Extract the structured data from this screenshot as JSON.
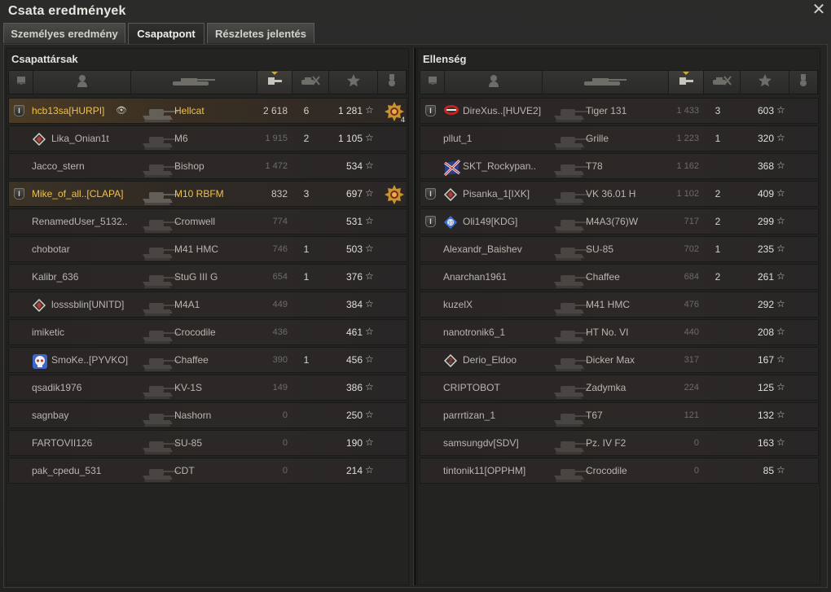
{
  "window": {
    "title": "Csata eredmények",
    "close_icon": "close-icon"
  },
  "tabs": [
    {
      "label": "Személyes eredmény",
      "active": false
    },
    {
      "label": "Csapatpont",
      "active": true
    },
    {
      "label": "Részletes jelentés",
      "active": false
    }
  ],
  "columns": [
    "squad-icon",
    "player-icon",
    "vehicle-icon",
    "damage-icon",
    "kills-icon",
    "xp-star-icon",
    "medal-icon"
  ],
  "colors": {
    "gold": "#f1c14d",
    "self_row": "#4b3b25",
    "squad_row": "#3c3326"
  },
  "allies": {
    "title": "Csapattársak",
    "rows": [
      {
        "squad": "I",
        "clan_icon": "",
        "name": "hcb13sa[HURPI]",
        "name_color": "gold",
        "eye": true,
        "vehicle": "Hellcat",
        "damage": "2 618",
        "kills": "6",
        "xp": "1 281",
        "medal": true,
        "medal_count": "4",
        "row_style": "self"
      },
      {
        "squad": "",
        "clan_icon": "diamond",
        "name": "Lika_Onian1t",
        "vehicle": "M6",
        "damage": "1 915",
        "kills": "2",
        "xp": "1 105",
        "row_style": "dead"
      },
      {
        "squad": "",
        "clan_icon": "",
        "name": "Jacco_stern",
        "vehicle": "Bishop",
        "damage": "1 472",
        "kills": "",
        "xp": "534",
        "row_style": "dead"
      },
      {
        "squad": "I",
        "clan_icon": "",
        "name": "Mike_of_all..[CLAPA]",
        "name_color": "gold",
        "vehicle": "M10 RBFM",
        "damage": "832",
        "kills": "3",
        "xp": "697",
        "medal": true,
        "medal_count": "",
        "row_style": "squad"
      },
      {
        "squad": "",
        "clan_icon": "",
        "name": "RenamedUser_5132..",
        "vehicle": "Cromwell",
        "damage": "774",
        "kills": "",
        "xp": "531",
        "row_style": "dead"
      },
      {
        "squad": "",
        "clan_icon": "",
        "name": "chobotar",
        "vehicle": "M41 HMC",
        "damage": "746",
        "kills": "1",
        "xp": "503",
        "row_style": "dead"
      },
      {
        "squad": "",
        "clan_icon": "",
        "name": "Kalibr_636",
        "vehicle": "StuG III G",
        "damage": "654",
        "kills": "1",
        "xp": "376",
        "row_style": "dead"
      },
      {
        "squad": "",
        "clan_icon": "diamond",
        "name": "losssblin[UNITD]",
        "vehicle": "M4A1",
        "damage": "449",
        "kills": "",
        "xp": "384",
        "row_style": "dead"
      },
      {
        "squad": "",
        "clan_icon": "",
        "name": "imiketic",
        "vehicle": "Crocodile",
        "damage": "436",
        "kills": "",
        "xp": "461",
        "row_style": "dead"
      },
      {
        "squad": "",
        "clan_icon": "skull",
        "name": "SmoKe..[PYVKO]",
        "vehicle": "Chaffee",
        "damage": "390",
        "kills": "1",
        "xp": "456",
        "row_style": "dead"
      },
      {
        "squad": "",
        "clan_icon": "",
        "name": "qsadik1976",
        "vehicle": "KV-1S",
        "damage": "149",
        "kills": "",
        "xp": "386",
        "row_style": "dead"
      },
      {
        "squad": "",
        "clan_icon": "",
        "name": "sagnbay",
        "vehicle": "Nashorn",
        "damage": "0",
        "kills": "",
        "xp": "250",
        "row_style": "dead"
      },
      {
        "squad": "",
        "clan_icon": "",
        "name": "FARTOVII126",
        "vehicle": "SU-85",
        "damage": "0",
        "kills": "",
        "xp": "190",
        "row_style": "dead"
      },
      {
        "squad": "",
        "clan_icon": "",
        "name": "pak_cpedu_531",
        "vehicle": "CDT",
        "damage": "0",
        "kills": "",
        "xp": "214",
        "row_style": "dead"
      }
    ]
  },
  "enemies": {
    "title": "Ellenség",
    "rows": [
      {
        "squad": "I",
        "clan_icon": "red-emblem",
        "name": "DireXus..[HUVE2]",
        "vehicle": "Tiger 131",
        "damage": "1 433",
        "kills": "3",
        "xp": "603",
        "row_style": "dead"
      },
      {
        "squad": "",
        "clan_icon": "",
        "name": "pllut_1",
        "vehicle": "Grille",
        "damage": "1 223",
        "kills": "1",
        "xp": "320",
        "row_style": "dead"
      },
      {
        "squad": "",
        "clan_icon": "flag",
        "name": "SKT_Rockypan..",
        "vehicle": "T78",
        "damage": "1 162",
        "kills": "",
        "xp": "368",
        "row_style": "dead"
      },
      {
        "squad": "I",
        "clan_icon": "diamond",
        "name": "Pisanka_1[IXK]",
        "vehicle": "VK 36.01 H",
        "damage": "1 102",
        "kills": "2",
        "xp": "409",
        "row_style": "dead"
      },
      {
        "squad": "I",
        "clan_icon": "blue-badge",
        "name": "Oli149[KDG]",
        "vehicle": "M4A3(76)W",
        "damage": "717",
        "kills": "2",
        "xp": "299",
        "row_style": "dead"
      },
      {
        "squad": "",
        "clan_icon": "",
        "name": "Alexandr_Baishev",
        "vehicle": "SU-85",
        "damage": "702",
        "kills": "1",
        "xp": "235",
        "row_style": "dead"
      },
      {
        "squad": "",
        "clan_icon": "",
        "name": "Anarchan1961",
        "vehicle": "Chaffee",
        "damage": "684",
        "kills": "2",
        "xp": "261",
        "row_style": "dead"
      },
      {
        "squad": "",
        "clan_icon": "",
        "name": "kuzelX",
        "vehicle": "M41 HMC",
        "damage": "476",
        "kills": "",
        "xp": "292",
        "row_style": "dead"
      },
      {
        "squad": "",
        "clan_icon": "",
        "name": "nanotronik6_1",
        "vehicle": "HT No. VI",
        "damage": "440",
        "kills": "",
        "xp": "208",
        "row_style": "dead"
      },
      {
        "squad": "",
        "clan_icon": "diamond2",
        "name": "Derio_Eldoo",
        "vehicle": "Dicker Max",
        "damage": "317",
        "kills": "",
        "xp": "167",
        "row_style": "dead"
      },
      {
        "squad": "",
        "clan_icon": "",
        "name": "CRIPTOBOT",
        "vehicle": "Zadymka",
        "damage": "224",
        "kills": "",
        "xp": "125",
        "row_style": "dead"
      },
      {
        "squad": "",
        "clan_icon": "",
        "name": "parrrtizan_1",
        "vehicle": "T67",
        "damage": "121",
        "kills": "",
        "xp": "132",
        "row_style": "dead"
      },
      {
        "squad": "",
        "clan_icon": "",
        "name": "samsungdv[SDV]",
        "vehicle": "Pz. IV F2",
        "damage": "0",
        "kills": "",
        "xp": "163",
        "row_style": "dead"
      },
      {
        "squad": "",
        "clan_icon": "",
        "name": "tintonik11[OPPHM]",
        "vehicle": "Crocodile",
        "damage": "0",
        "kills": "",
        "xp": "85",
        "row_style": "dead"
      }
    ]
  }
}
